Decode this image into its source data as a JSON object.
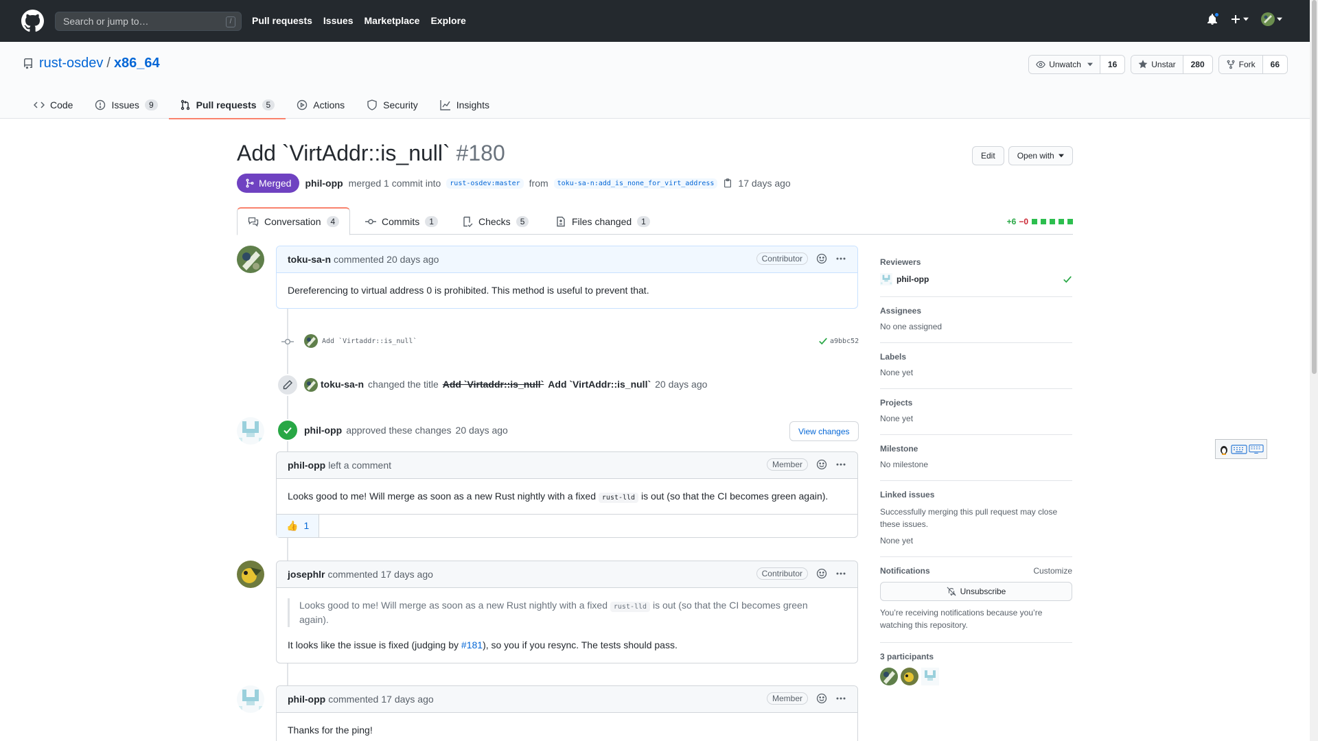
{
  "header": {
    "search_placeholder": "Search or jump to…",
    "search_shortcut": "/",
    "nav": [
      "Pull requests",
      "Issues",
      "Marketplace",
      "Explore"
    ]
  },
  "repo": {
    "owner": "rust-osdev",
    "separator": "/",
    "name": "x86_64",
    "watch_label": "Unwatch",
    "watch_count": "16",
    "star_label": "Unstar",
    "star_count": "280",
    "fork_label": "Fork",
    "fork_count": "66",
    "tabs": [
      {
        "label": "Code",
        "count": ""
      },
      {
        "label": "Issues",
        "count": "9"
      },
      {
        "label": "Pull requests",
        "count": "5"
      },
      {
        "label": "Actions",
        "count": ""
      },
      {
        "label": "Security",
        "count": ""
      },
      {
        "label": "Insights",
        "count": ""
      }
    ]
  },
  "pr": {
    "title": "Add `VirtAddr::is_null`",
    "number": "#180",
    "edit_label": "Edit",
    "open_with_label": "Open with",
    "state": "Merged",
    "merger": "phil-opp",
    "merge_text": "merged 1 commit into",
    "base_branch": "rust-osdev:master",
    "from_text": "from",
    "head_branch": "toku-sa-n:add_is_none_for_virt_address",
    "merged_ago": "17 days ago",
    "tabs": [
      {
        "label": "Conversation",
        "count": "4"
      },
      {
        "label": "Commits",
        "count": "1"
      },
      {
        "label": "Checks",
        "count": "5"
      },
      {
        "label": "Files changed",
        "count": "1"
      }
    ],
    "additions": "+6",
    "deletions": "−0"
  },
  "timeline": {
    "c1": {
      "author": "toku-sa-n",
      "action": "commented",
      "time": "20 days ago",
      "role": "Contributor",
      "body": "Dereferencing to virtual address 0 is prohibited. This method is useful to prevent that."
    },
    "commit": {
      "message": "Add `Virtaddr::is_null`",
      "sha": "a9bbc52"
    },
    "rename": {
      "author": "toku-sa-n",
      "text": "changed the title",
      "old_title": "Add `Virtaddr::is_null`",
      "new_title": "Add `VirtAddr::is_null`",
      "time": "20 days ago"
    },
    "review": {
      "author": "phil-opp",
      "text": "approved these changes",
      "time": "20 days ago",
      "button": "View changes"
    },
    "c2": {
      "author": "phil-opp",
      "action": "left a comment",
      "role": "Member",
      "body_pre": "Looks good to me! Will merge as soon as a new Rust nightly with a fixed",
      "body_code": "rust-lld",
      "body_post": "is out (so that the CI becomes green again).",
      "reaction_emoji": "👍",
      "reaction_count": "1"
    },
    "c3": {
      "author": "josephlr",
      "action": "commented",
      "time": "17 days ago",
      "role": "Contributor",
      "quote_pre": "Looks good to me! Will merge as soon as a new Rust nightly with a fixed",
      "quote_code": "rust-lld",
      "quote_post": "is out (so that the CI becomes green again).",
      "body_pre": "It looks like the issue is fixed (judging by",
      "body_link": "#181",
      "body_post": "), so you if you resync. The tests should pass."
    },
    "c4": {
      "author": "phil-opp",
      "action": "commented",
      "time": "17 days ago",
      "role": "Member",
      "body": "Thanks for the ping!"
    }
  },
  "sidebar": {
    "reviewers_heading": "Reviewers",
    "reviewer": "phil-opp",
    "assignees_heading": "Assignees",
    "assignees_value": "No one assigned",
    "labels_heading": "Labels",
    "labels_value": "None yet",
    "projects_heading": "Projects",
    "projects_value": "None yet",
    "milestone_heading": "Milestone",
    "milestone_value": "No milestone",
    "linked_heading": "Linked issues",
    "linked_desc": "Successfully merging this pull request may close these issues.",
    "linked_value": "None yet",
    "notifications_heading": "Notifications",
    "customize_label": "Customize",
    "unsubscribe_label": "Unsubscribe",
    "notif_reason": "You’re receiving notifications because you’re watching this repository.",
    "participants_heading": "3 participants"
  },
  "colors": {
    "header_bg": "#24292e",
    "merged_purple": "#6f42c1",
    "link_blue": "#0366d6",
    "tab_underline": "#f9826c",
    "success_green": "#28a745"
  }
}
